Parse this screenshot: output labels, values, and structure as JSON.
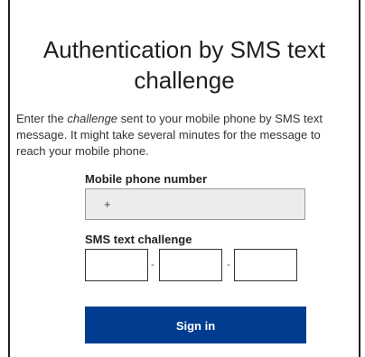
{
  "page": {
    "title": "Authentication by SMS text challenge"
  },
  "intro": {
    "prefix": "Enter the ",
    "emphasis": "challenge",
    "suffix": " sent to your mobile phone by SMS text message. It might take several minutes for the message to reach your mobile phone."
  },
  "phone": {
    "label": "Mobile phone number",
    "value": "+"
  },
  "sms": {
    "label": "SMS text challenge",
    "separator": "-"
  },
  "actions": {
    "sign_in_label": "Sign in"
  },
  "colors": {
    "primary_button": "#003c8f",
    "field_background": "#ececec"
  }
}
